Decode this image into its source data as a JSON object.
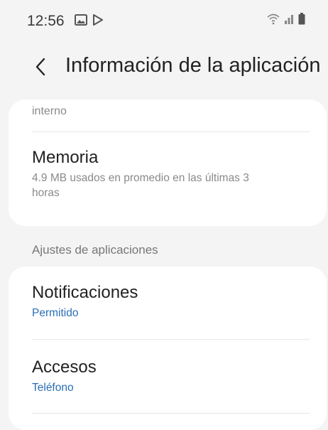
{
  "status_bar": {
    "time": "12:56",
    "left_icons": [
      "image-icon",
      "play-store-icon"
    ],
    "right_icons": [
      "wifi-icon",
      "signal-icon",
      "battery-icon"
    ]
  },
  "header": {
    "title": "Información de la aplicación"
  },
  "storage_card": {
    "partial_label": "interno",
    "memory": {
      "title": "Memoria",
      "subtitle": "4.9 MB usados en promedio en las últimas 3 horas"
    }
  },
  "section": {
    "label": "Ajustes de aplicaciones"
  },
  "settings": [
    {
      "title": "Notificaciones",
      "subtitle": "Permitido"
    },
    {
      "title": "Accesos",
      "subtitle": "Teléfono"
    }
  ],
  "colors": {
    "accent": "#2a6fb5",
    "background": "#f4f4f4",
    "card": "#ffffff"
  }
}
